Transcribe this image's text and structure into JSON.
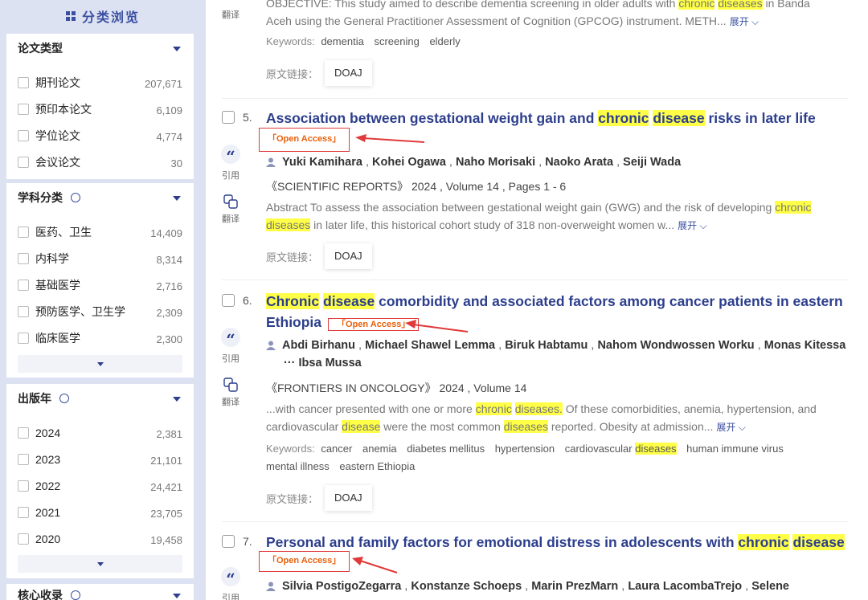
{
  "sidebar": {
    "title": "分类浏览",
    "groups": [
      {
        "title": "论文类型",
        "items": [
          {
            "label": "期刊论文",
            "count": "207,671"
          },
          {
            "label": "预印本论文",
            "count": "6,109"
          },
          {
            "label": "学位论文",
            "count": "4,774"
          },
          {
            "label": "会议论文",
            "count": "30"
          }
        ]
      },
      {
        "title": "学科分类",
        "items": [
          {
            "label": "医药、卫生",
            "count": "14,409"
          },
          {
            "label": "内科学",
            "count": "8,314"
          },
          {
            "label": "基础医学",
            "count": "2,716"
          },
          {
            "label": "预防医学、卫生学",
            "count": "2,309"
          },
          {
            "label": "临床医学",
            "count": "2,300"
          }
        ]
      },
      {
        "title": "出版年",
        "items": [
          {
            "label": "2024",
            "count": "2,381"
          },
          {
            "label": "2023",
            "count": "21,101"
          },
          {
            "label": "2022",
            "count": "24,421"
          },
          {
            "label": "2021",
            "count": "23,705"
          },
          {
            "label": "2020",
            "count": "19,458"
          }
        ]
      },
      {
        "title": "核心收录"
      }
    ]
  },
  "actions": {
    "cite": "引用",
    "translate": "翻译"
  },
  "labels": {
    "link": "原文链接：",
    "keywords": "Keywords:",
    "expand": "展开"
  },
  "results": {
    "r4": {
      "abstract": "OBJECTIVE: This study aimed to describe dementia screening in older adults with ",
      "abstract_hl1": "chronic",
      "abstract_hl2": "diseases",
      "abstract_tail": " in Banda Aceh using the General Practitioner Assessment of Cognition (GPCOG) instrument. METH...",
      "keywords": [
        "dementia",
        "screening",
        "elderly"
      ],
      "link": "DOAJ"
    },
    "r5": {
      "num": "5.",
      "title_a": "Association between gestational weight gain and ",
      "title_hl1": "chronic",
      "title_hl2": "disease",
      "title_b": " risks in later life",
      "oa": "「Open Access」",
      "authors": [
        "Yuki Kamihara",
        "Kohei Ogawa",
        "Naho Morisaki",
        "Naoko Arata",
        "Seiji Wada"
      ],
      "source": "《SCIENTIFIC REPORTS》 2024 , Volume 14 , Pages 1 - 6",
      "abstract_a": "Abstract To assess the association between gestational weight gain (GWG) and the risk of developing ",
      "abstract_hl1": "chronic",
      "abstract_hl2": "diseases",
      "abstract_b": " in later life, this historical cohort study of 318 non-overweight women w...",
      "link": "DOAJ"
    },
    "r6": {
      "num": "6.",
      "title_hl1": "Chronic",
      "title_hl2": "disease",
      "title_a": " comorbidity and associated factors among cancer patients in eastern",
      "title_b": "Ethiopia",
      "oa": "「Open Access」",
      "authors": [
        "Abdi Birhanu",
        "Michael Shawel Lemma",
        "Biruk Habtamu",
        "Nahom Wondwossen Worku",
        "Monas Kitessa"
      ],
      "authors_more": "Ibsa Mussa",
      "ellipsis": "···",
      "source": "《FRONTIERS IN ONCOLOGY》 2024 , Volume 14",
      "abstract_a": "...with cancer presented with one or more ",
      "abstract_hl1": "chronic",
      "abstract_hl2": "diseases.",
      "abstract_b": " Of these comorbidities, anemia, hypertension, and",
      "abstract_c": "cardiovascular ",
      "abstract_hl3": "disease",
      "abstract_d": " were the most common ",
      "abstract_hl4": "diseases",
      "abstract_e": " reported. Obesity at admission...",
      "keywords_a": [
        "cancer",
        "anemia",
        "diabetes mellitus",
        "hypertension",
        "cardiovascular"
      ],
      "keywords_hl": "diseases",
      "keywords_b": [
        "human immune virus"
      ],
      "keywords_c": [
        "mental illness",
        "eastern Ethiopia"
      ],
      "link": "DOAJ"
    },
    "r7": {
      "num": "7.",
      "title_a": "Personal and family factors for emotional distress in adolescents with ",
      "title_hl1": "chronic",
      "title_hl2": "disease",
      "oa": "「Open Access」",
      "authors": [
        "Silvia PostigoZegarra",
        "Konstanze Schoeps",
        "Marin PrezMarn",
        "Laura LacombaTrejo",
        "Selene"
      ]
    }
  },
  "colors": {
    "accent": "#2c3e8c",
    "highlight": "#ffff47",
    "oa_text": "#e8600b",
    "annotation_red": "#e03a3a"
  },
  "icons": [
    "grid-icon",
    "search-icon",
    "caret-down-icon",
    "quote-icon",
    "translate-icon",
    "person-icon",
    "arrow-annotation"
  ]
}
